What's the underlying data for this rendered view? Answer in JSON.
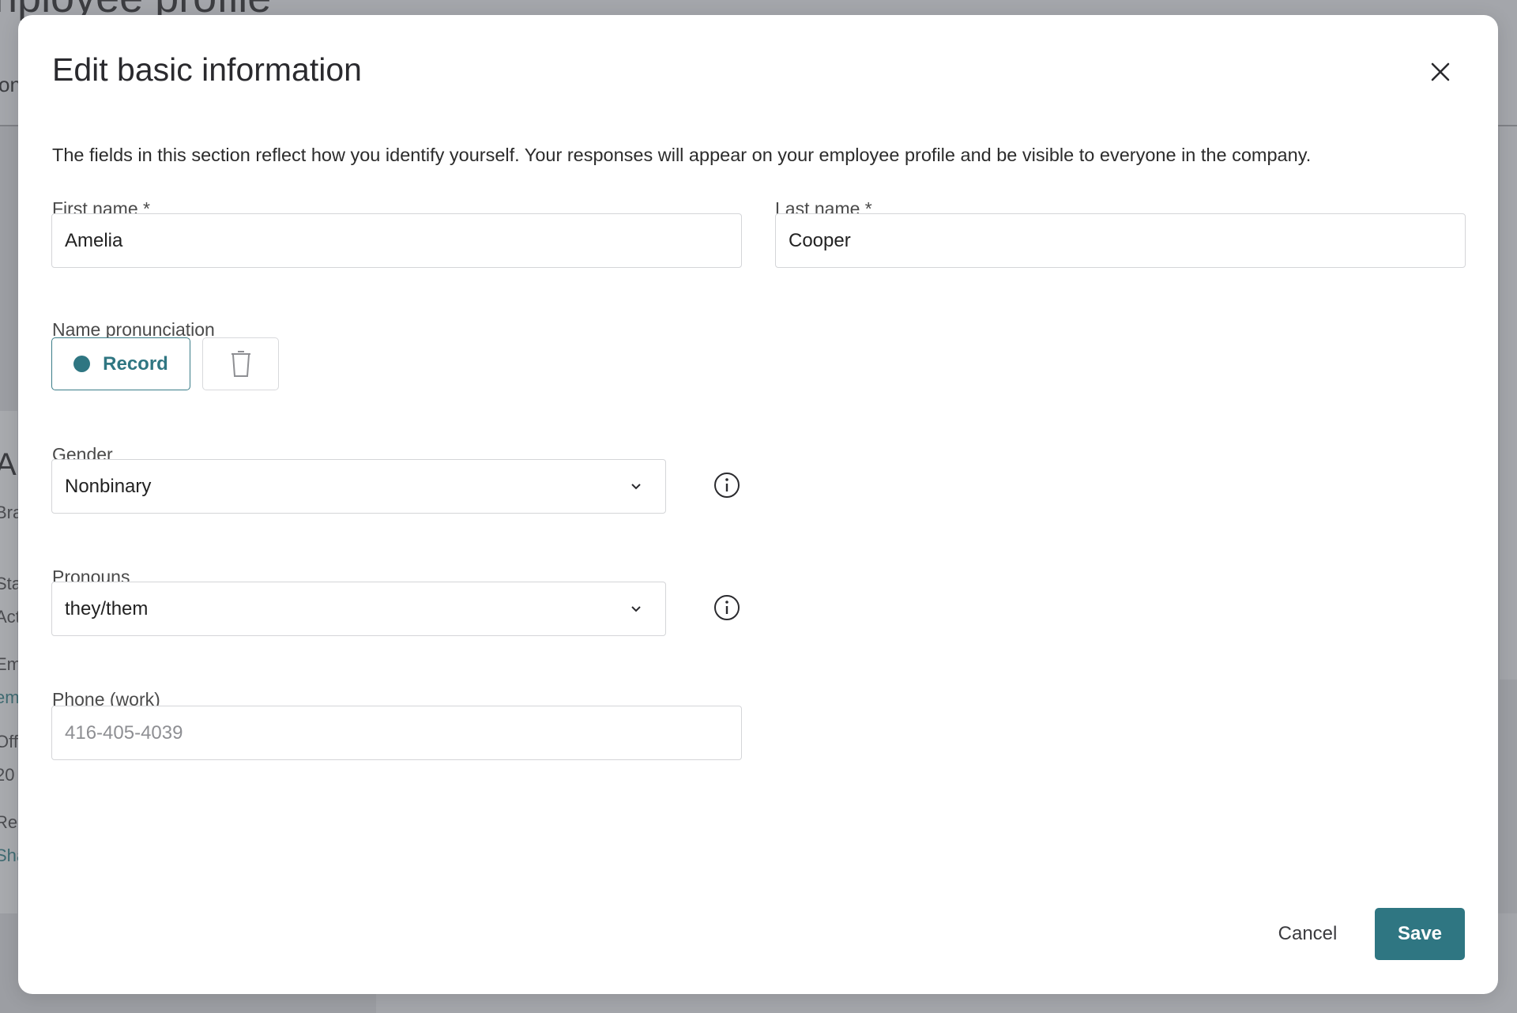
{
  "background": {
    "page_title": "nployee profile",
    "tab_fragment": "ona",
    "snippets": [
      "Ar",
      "Bra",
      "Sta",
      "Act",
      "Em",
      "em",
      "Off",
      "20",
      "Rep",
      "Sha"
    ]
  },
  "modal": {
    "title": "Edit basic information",
    "description": "The fields in this section reflect how you identify yourself. Your responses will appear on your employee profile and be visible to everyone in the company.",
    "first_name": {
      "label": "First name *",
      "value": "Amelia"
    },
    "last_name": {
      "label": "Last name *",
      "value": "Cooper"
    },
    "pronunciation": {
      "label": "Name pronunciation",
      "record_label": "Record"
    },
    "gender": {
      "label": "Gender",
      "value": "Nonbinary"
    },
    "pronouns": {
      "label": "Pronouns",
      "value": "they/them"
    },
    "phone": {
      "label": "Phone (work)",
      "placeholder": "416-405-4039"
    },
    "actions": {
      "cancel": "Cancel",
      "save": "Save"
    }
  },
  "colors": {
    "accent": "#2f7682",
    "overlay": "#a4a6ab"
  }
}
